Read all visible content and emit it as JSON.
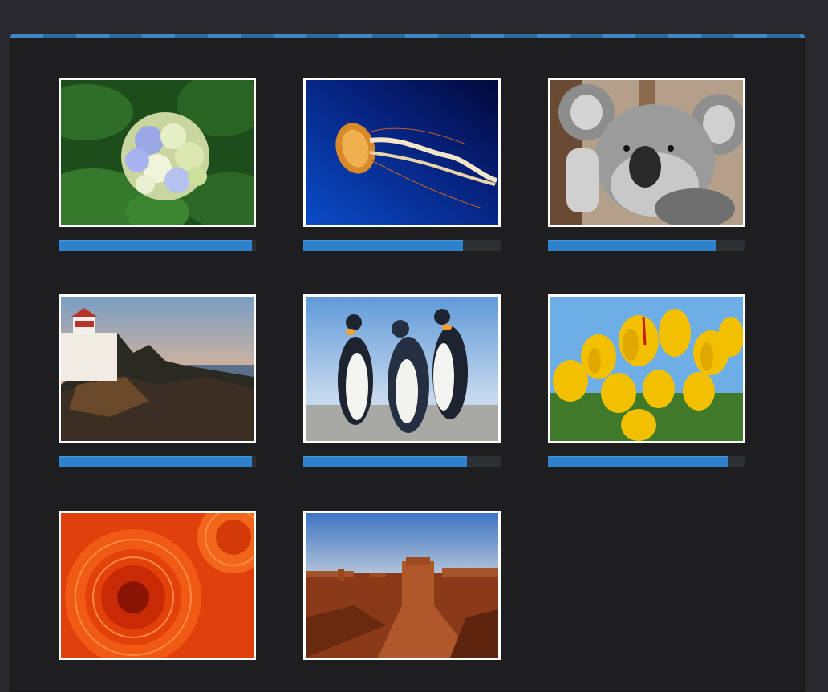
{
  "colors": {
    "accent": "#2e82cc",
    "page_background": "#29292d",
    "panel_background": "#1e1e21",
    "track": "#2c2f34"
  },
  "gallery": {
    "items": [
      {
        "subject": "hydrangea",
        "progress": 0.98
      },
      {
        "subject": "jellyfish",
        "progress": 0.81
      },
      {
        "subject": "koala",
        "progress": 0.85
      },
      {
        "subject": "lighthouse",
        "progress": 0.98
      },
      {
        "subject": "penguins",
        "progress": 0.83
      },
      {
        "subject": "tulips",
        "progress": 0.91
      },
      {
        "subject": "chrysanthemum",
        "progress": null
      },
      {
        "subject": "desert",
        "progress": null
      }
    ]
  }
}
